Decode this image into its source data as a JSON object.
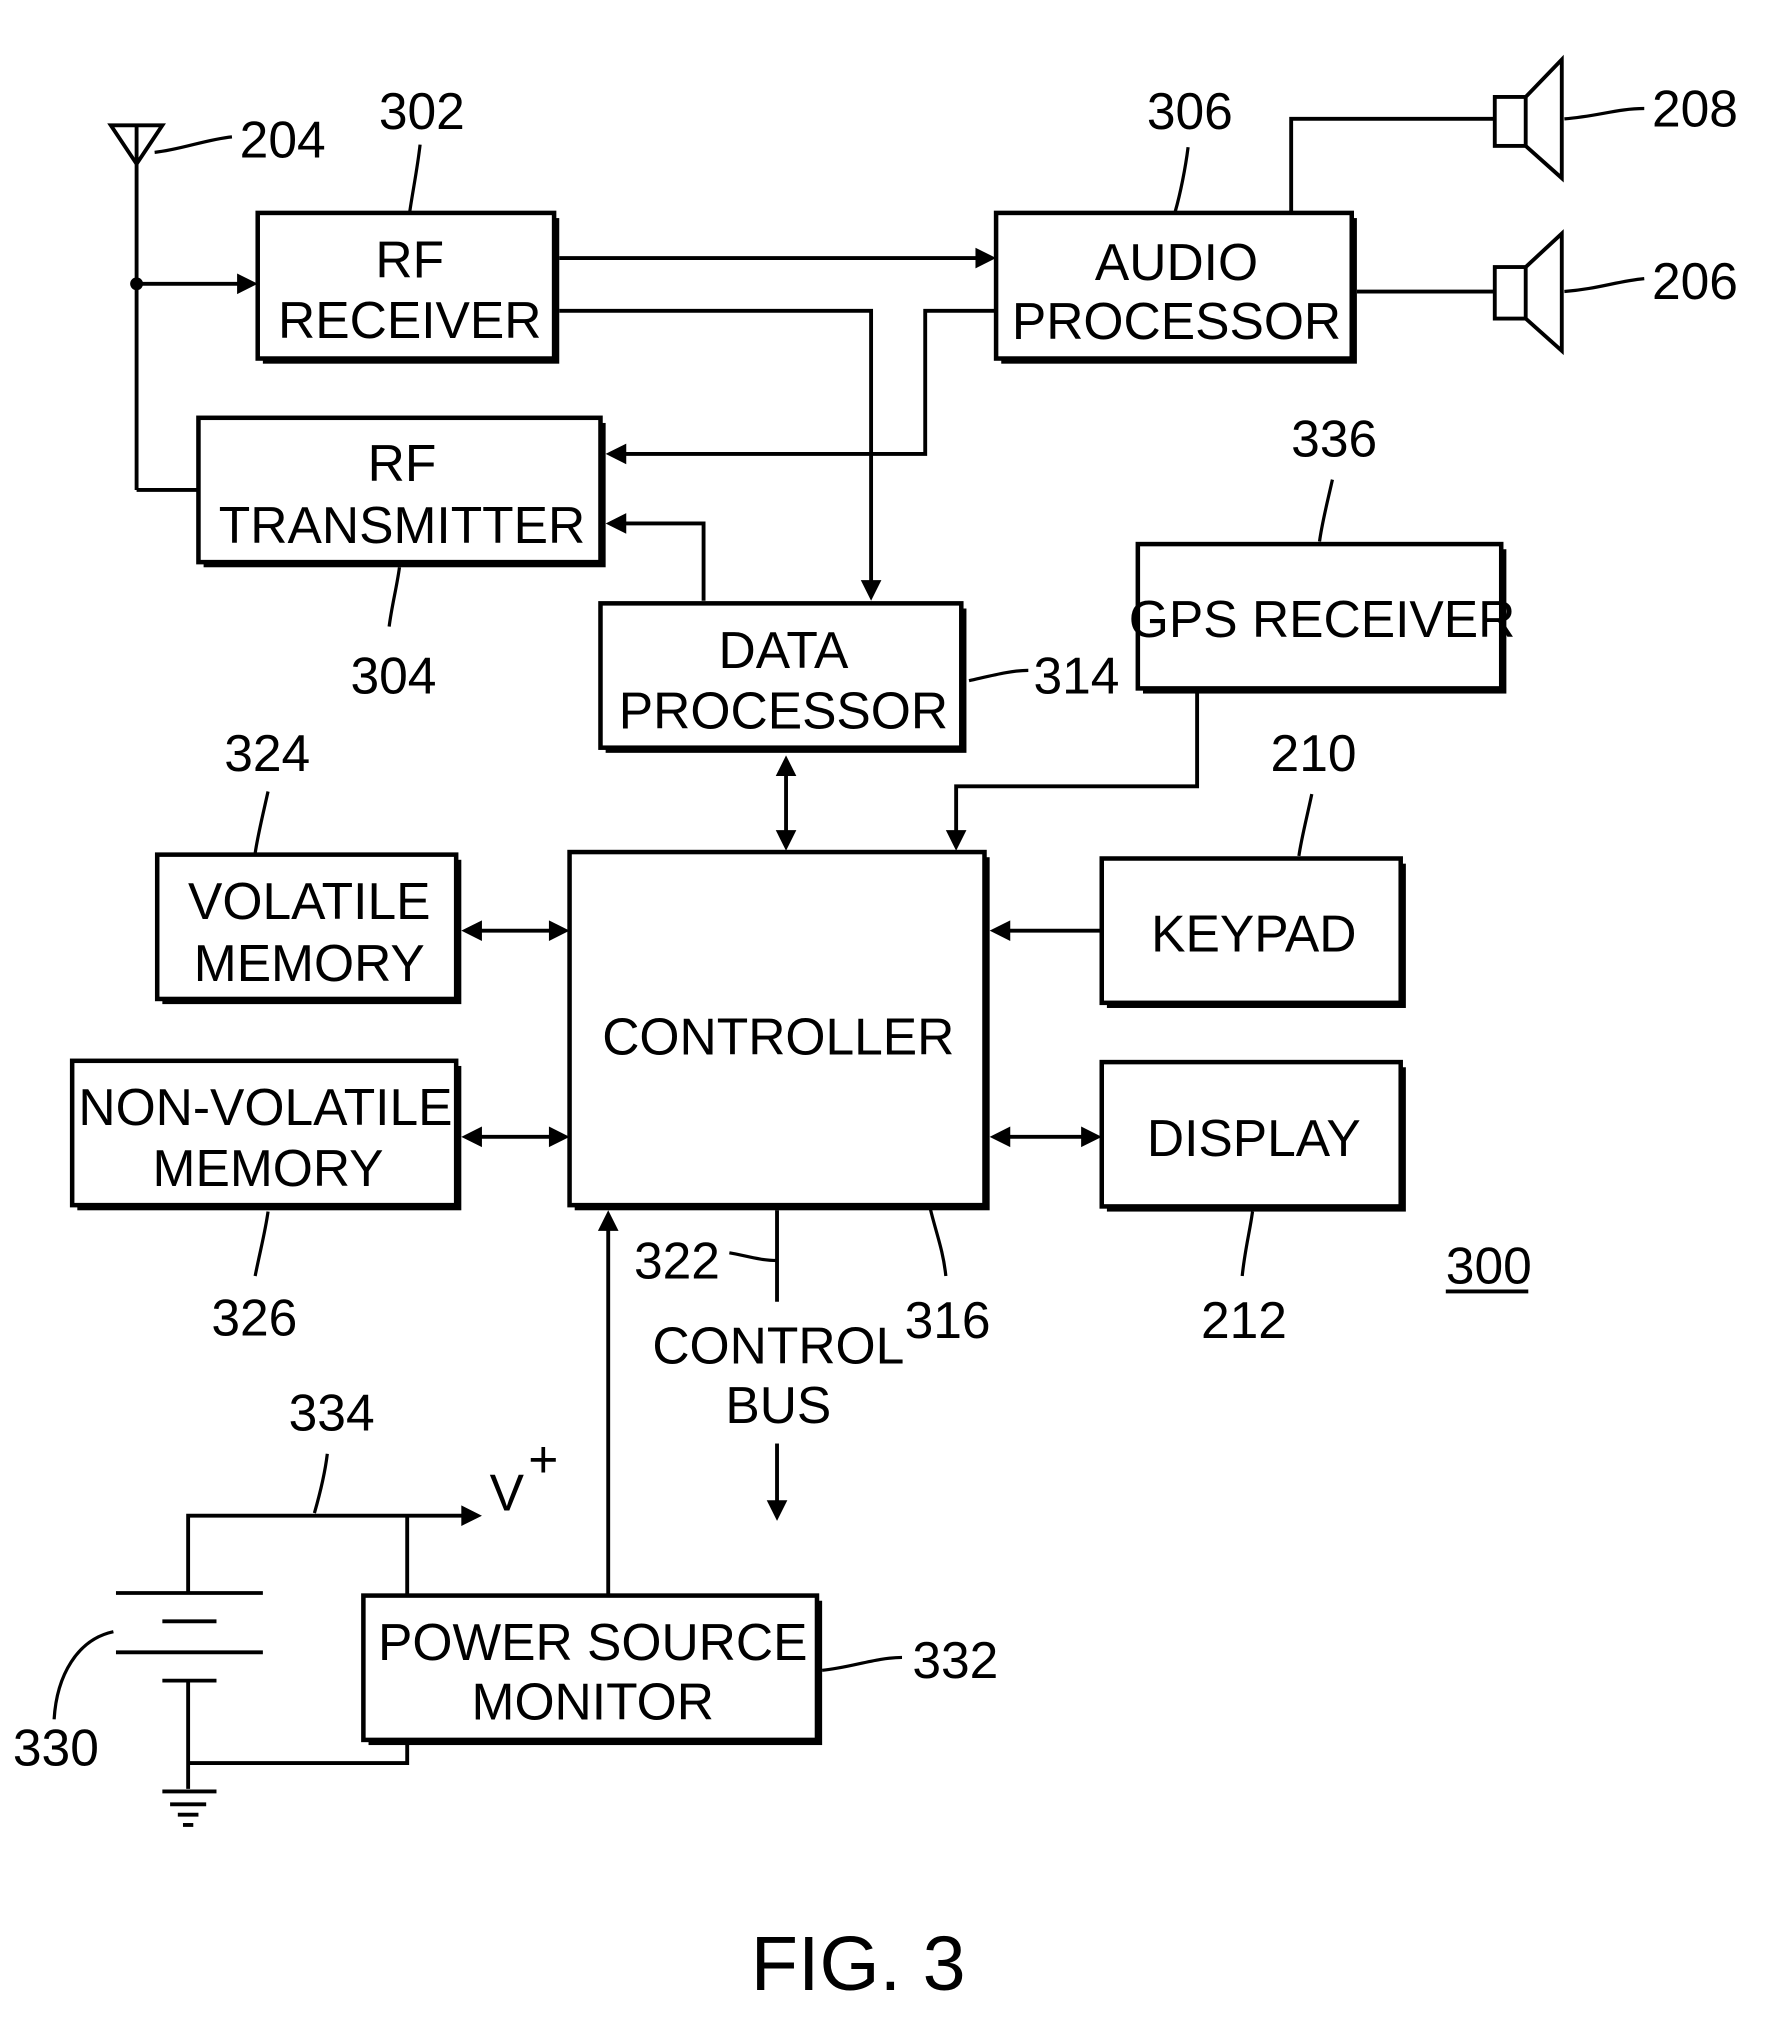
{
  "figure": {
    "title": "FIG. 3",
    "ref": "300"
  },
  "blocks": {
    "rf_receiver": {
      "line1": "RF",
      "line2": "RECEIVER",
      "ref": "302"
    },
    "rf_transmitter": {
      "line1": "RF",
      "line2": "TRANSMITTER",
      "ref": "304"
    },
    "audio_processor": {
      "line1": "AUDIO",
      "line2": "PROCESSOR",
      "ref": "306"
    },
    "data_processor": {
      "line1": "DATA",
      "line2": "PROCESSOR",
      "ref": "314"
    },
    "gps_receiver": {
      "line1": "GPS RECEIVER",
      "ref": "336"
    },
    "volatile_memory": {
      "line1": "VOLATILE",
      "line2": "MEMORY",
      "ref": "324"
    },
    "non_volatile_memory": {
      "line1": "NON-VOLATILE",
      "line2": "MEMORY",
      "ref": "326"
    },
    "controller": {
      "line1": "CONTROLLER",
      "ref": "316"
    },
    "keypad": {
      "line1": "KEYPAD",
      "ref": "210"
    },
    "display": {
      "line1": "DISPLAY",
      "ref": "212"
    },
    "power_source_monitor": {
      "line1": "POWER SOURCE",
      "line2": "MONITOR",
      "ref": "332"
    }
  },
  "components": {
    "antenna_ref": "204",
    "speaker_top_ref": "208",
    "speaker_bottom_ref": "206",
    "battery_ref": "330",
    "supply_line_ref": "334",
    "supply_label": "V",
    "supply_sign": "+",
    "control_bus_ref": "322",
    "control_bus_line1": "CONTROL",
    "control_bus_line2": "BUS"
  }
}
